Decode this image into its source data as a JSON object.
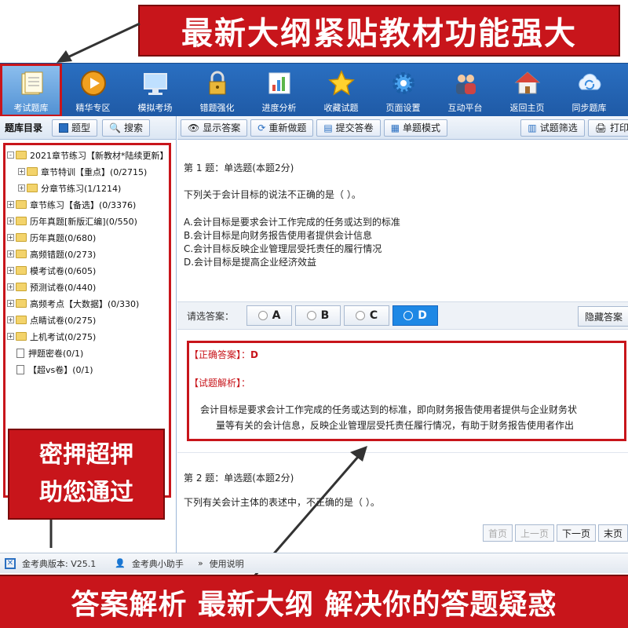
{
  "banner_top": {
    "text": "最新大纲紧贴教材功能强大"
  },
  "banner_bottom": {
    "text": "答案解析 最新大纲 解决你的答题疑惑"
  },
  "promo_left": {
    "line1": "密押超押",
    "line2": "助您通过"
  },
  "toolbar": {
    "items": [
      {
        "label": "考试题库",
        "icon": "book-icon"
      },
      {
        "label": "精华专区",
        "icon": "play-icon"
      },
      {
        "label": "模拟考场",
        "icon": "monitor-icon"
      },
      {
        "label": "错题强化",
        "icon": "lock-icon"
      },
      {
        "label": "进度分析",
        "icon": "chart-icon"
      },
      {
        "label": "收藏试题",
        "icon": "star-icon"
      },
      {
        "label": "页面设置",
        "icon": "gear-icon"
      },
      {
        "label": "互动平台",
        "icon": "users-icon"
      },
      {
        "label": "返回主页",
        "icon": "home-icon"
      },
      {
        "label": "同步题库",
        "icon": "sync-icon"
      }
    ]
  },
  "left": {
    "title": "题库目录",
    "type_btn": "题型",
    "search_btn": "搜索",
    "tree": [
      {
        "label": "2021章节练习【新教材*陆续更新】",
        "level": 0,
        "kind": "folder",
        "exp": "-"
      },
      {
        "label": "章节特训【重点】(0/2715)",
        "level": 1,
        "kind": "folder",
        "exp": "+"
      },
      {
        "label": "分章节练习(1/1214)",
        "level": 1,
        "kind": "folder",
        "exp": "+"
      },
      {
        "label": "章节练习【备选】(0/3376)",
        "level": 0,
        "kind": "folder",
        "exp": "+"
      },
      {
        "label": "历年真题[新版汇编](0/550)",
        "level": 0,
        "kind": "folder",
        "exp": "+"
      },
      {
        "label": "历年真题(0/680)",
        "level": 0,
        "kind": "folder",
        "exp": "+"
      },
      {
        "label": "高频错题(0/273)",
        "level": 0,
        "kind": "folder",
        "exp": "+"
      },
      {
        "label": "模考试卷(0/605)",
        "level": 0,
        "kind": "folder",
        "exp": "+"
      },
      {
        "label": "预测试卷(0/440)",
        "level": 0,
        "kind": "folder",
        "exp": "+"
      },
      {
        "label": "高频考点【大数据】(0/330)",
        "level": 0,
        "kind": "folder",
        "exp": "+"
      },
      {
        "label": "点睛试卷(0/275)",
        "level": 0,
        "kind": "folder",
        "exp": "+"
      },
      {
        "label": "上机考试(0/275)",
        "level": 0,
        "kind": "folder",
        "exp": "+"
      },
      {
        "label": "押题密卷(0/1)",
        "level": 0,
        "kind": "doc",
        "exp": ""
      },
      {
        "label": "【超vs卷】(0/1)",
        "level": 0,
        "kind": "doc",
        "exp": ""
      }
    ]
  },
  "right_toolbar": {
    "show_answer": "显示答案",
    "redo": "重新做题",
    "submit": "提交答卷",
    "single_mode": "单题模式",
    "filter": "试题筛选",
    "print": "打印"
  },
  "question1": {
    "head": "第 1 题：单选题(本题2分)",
    "stem": "下列关于会计目标的说法不正确的是（ ）。",
    "options": [
      "A.会计目标是要求会计工作完成的任务或达到的标准",
      "B.会计目标是向财务报告使用者提供会计信息",
      "C.会计目标反映企业管理层受托责任的履行情况",
      "D.会计目标是提高企业经济效益"
    ]
  },
  "answer_bar": {
    "label": "请选答案：",
    "choices": [
      "A",
      "B",
      "C",
      "D"
    ],
    "selected": "D",
    "hide_btn": "隐藏答案"
  },
  "analysis": {
    "correct_label": "【正确答案】：",
    "correct_value": "D",
    "analysis_label": "【试题解析】：",
    "line1": "会计目标是要求会计工作完成的任务或达到的标准，即向财务报告使用者提供与企业财务状",
    "line2": "量等有关的会计信息，反映企业管理层受托责任履行情况，有助于财务报告使用者作出"
  },
  "question2": {
    "head": "第 2 题：单选题(本题2分)",
    "stem": "下列有关会计主体的表述中，不正确的是（ ）。"
  },
  "pager": {
    "first": "首页",
    "prev": "上一页",
    "next": "下一页",
    "last": "末页"
  },
  "status": {
    "version": "金考典版本: V25.1",
    "helper": "金考典小助手",
    "manual": "使用说明"
  },
  "colors": {
    "accent_red": "#c8151b",
    "toolbar_blue": "#2a6fc1",
    "selected_blue": "#1e88e5"
  }
}
